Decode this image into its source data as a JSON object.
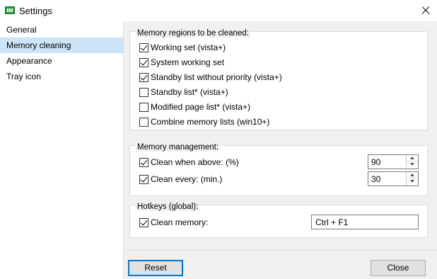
{
  "window": {
    "title": "Settings",
    "icon": "memory-chip-icon"
  },
  "sidebar": {
    "items": [
      {
        "label": "General",
        "active": false
      },
      {
        "label": "Memory cleaning",
        "active": true
      },
      {
        "label": "Appearance",
        "active": false
      },
      {
        "label": "Tray icon",
        "active": false
      }
    ]
  },
  "regions": {
    "title": "Memory regions to be cleaned:",
    "items": [
      {
        "label": "Working set (vista+)",
        "checked": true
      },
      {
        "label": "System working set",
        "checked": true
      },
      {
        "label": "Standby list without priority (vista+)",
        "checked": true
      },
      {
        "label": "Standby list* (vista+)",
        "checked": false
      },
      {
        "label": "Modified page list* (vista+)",
        "checked": false
      },
      {
        "label": "Combine memory lists (win10+)",
        "checked": false
      }
    ]
  },
  "management": {
    "title": "Memory management:",
    "items": [
      {
        "label": "Clean when above: (%)",
        "checked": true,
        "value": "90"
      },
      {
        "label": "Clean every: (min.)",
        "checked": true,
        "value": "30"
      }
    ]
  },
  "hotkeys": {
    "title": "Hotkeys (global):",
    "item": {
      "label": "Clean memory:",
      "checked": true,
      "value": "Ctrl + F1"
    }
  },
  "buttons": {
    "reset": "Reset",
    "close": "Close"
  },
  "colors": {
    "accent": "#0078d7",
    "selection": "#cce4f7",
    "panel": "#f0f0f0"
  }
}
